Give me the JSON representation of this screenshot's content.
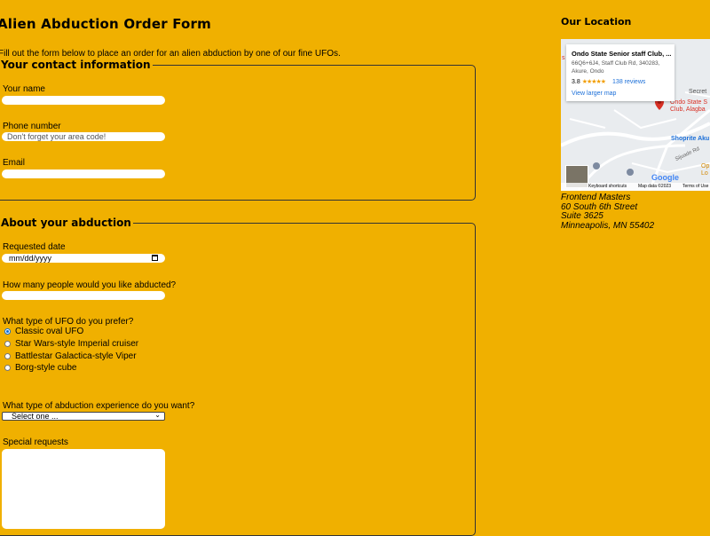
{
  "page": {
    "title": "Alien Abduction Order Form",
    "intro": "Fill out the form below to place an order for an alien abduction by one of our fine UFOs."
  },
  "contact": {
    "legend": "Your contact information",
    "name_label": "Your name",
    "name_value": "",
    "phone_label": "Phone number",
    "phone_placeholder": "Don't forget your area code!",
    "email_label": "Email",
    "email_value": ""
  },
  "abduction": {
    "legend": "About your abduction",
    "date_label": "Requested date",
    "date_placeholder": "mm/dd/yyyy",
    "people_label": "How many people would you like abducted?",
    "people_value": "",
    "ufo_label": "What type of UFO do you prefer?",
    "ufo_options": [
      {
        "label": "Classic oval UFO",
        "checked": true
      },
      {
        "label": "Star Wars-style Imperial cruiser",
        "checked": false
      },
      {
        "label": "Battlestar Galactica-style Viper",
        "checked": false
      },
      {
        "label": "Borg-style cube",
        "checked": false
      }
    ],
    "experience_label": "What type of abduction experience do you want?",
    "experience_selected": "Select one ...",
    "requests_label": "Special requests"
  },
  "location": {
    "title": "Our Location",
    "map": {
      "place_name": "Ondo State Senior staff Club, ...",
      "address_line1": "66Q6+6J4, Staff Club Rd, 340283,",
      "address_line2": "Akure, Ondo",
      "rating": "3.8",
      "stars": "★★★★★",
      "reviews": "138 reviews",
      "view_larger": "View larger map",
      "label_secret": "Secret",
      "label_club1": "Ondo State S",
      "label_club2": "Club, Alagba",
      "label_shoprite": "Shoprite Aku",
      "label_sijuade": "Sijuade Rd",
      "label_op1": "Op",
      "label_op2": "Lo",
      "google": "Google",
      "shortcuts": "Keyboard shortcuts",
      "mapdata": "Map data ©2023",
      "terms": "Terms of Use",
      "pin_color": "#d93025"
    },
    "address": {
      "line1": "Frontend Masters",
      "line2": "60 South 6th Street",
      "line3": "Suite 3625",
      "line4": "Minneapolis, MN 55402"
    }
  },
  "colors": {
    "background": "#f0b000",
    "accent": "#0a6cd6"
  }
}
